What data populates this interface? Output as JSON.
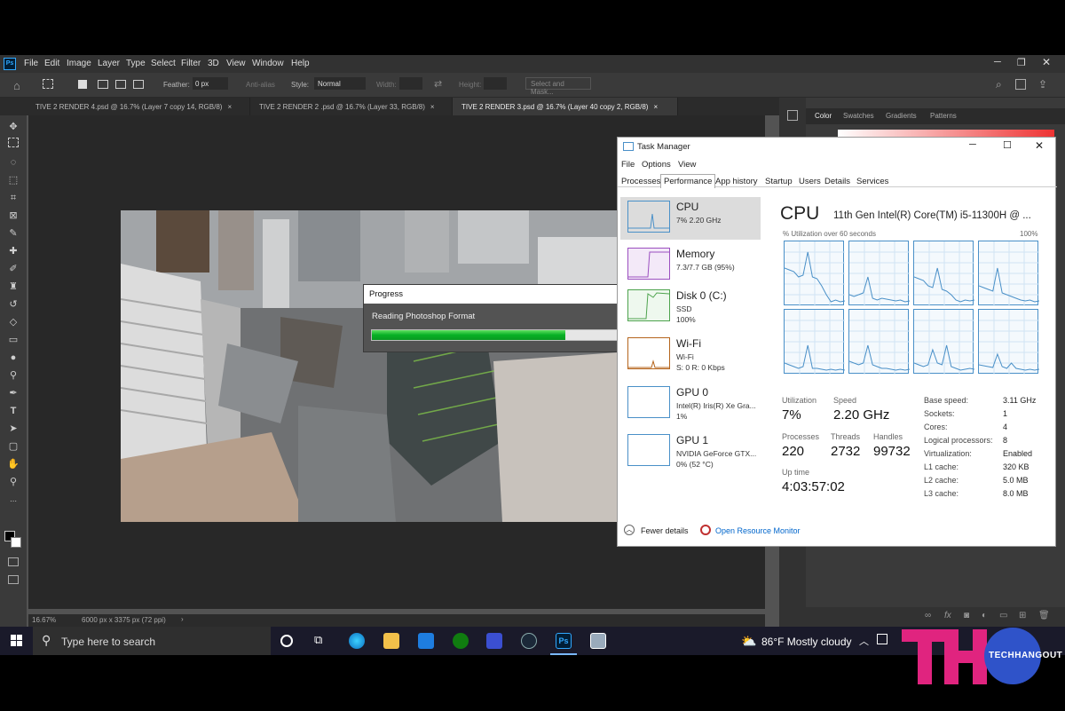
{
  "photoshop": {
    "menu": [
      "File",
      "Edit",
      "Image",
      "Layer",
      "Type",
      "Select",
      "Filter",
      "3D",
      "View",
      "Window",
      "Help"
    ],
    "options": {
      "feather_label": "Feather:",
      "feather_value": "0 px",
      "antialias_label": "Anti-alias",
      "style_label": "Style:",
      "style_value": "Normal",
      "width_label": "Width:",
      "height_label": "Height:",
      "select_mask": "Select and Mask..."
    },
    "tabs": [
      "TIVE 2 RENDER 4.psd @ 16.7% (Layer 7 copy 14, RGB/8)",
      "TIVE 2 RENDER 2 .psd @ 16.7% (Layer 33, RGB/8)",
      "TIVE 2 RENDER 3.psd @ 16.7% (Layer 40 copy 2, RGB/8)"
    ],
    "status": {
      "zoom": "16.67%",
      "doc_size": "6000 px x 3375 px (72 ppi)",
      "chevron": "›"
    },
    "panel_tabs": [
      "Color",
      "Swatches",
      "Gradients",
      "Patterns"
    ]
  },
  "progress": {
    "title": "Progress",
    "message": "Reading Photoshop Format",
    "value": 0.79
  },
  "taskmanager": {
    "title": "Task Manager",
    "menu": [
      "File",
      "Options",
      "View"
    ],
    "tabs": [
      "Processes",
      "Performance",
      "App history",
      "Startup",
      "Users",
      "Details",
      "Services"
    ],
    "side": [
      {
        "title": "CPU",
        "sub1": "7%  2.20 GHz",
        "sub2": "",
        "color": "#4a90c8"
      },
      {
        "title": "Memory",
        "sub1": "7.3/7.7 GB (95%)",
        "sub2": "",
        "color": "#9b4fc0"
      },
      {
        "title": "Disk 0 (C:)",
        "sub1": "SSD",
        "sub2": "100%",
        "color": "#4da34d"
      },
      {
        "title": "Wi-Fi",
        "sub1": "Wi-Fi",
        "sub2": "S: 0 R: 0 Kbps",
        "color": "#b5651d"
      },
      {
        "title": "GPU 0",
        "sub1": "Intel(R) Iris(R) Xe Gra...",
        "sub2": "1%",
        "color": "#4a90c8"
      },
      {
        "title": "GPU 1",
        "sub1": "NVIDIA GeForce GTX...",
        "sub2": "0%  (52 °C)",
        "color": "#4a90c8"
      }
    ],
    "main_title": "CPU",
    "cpu_name": "11th Gen Intel(R) Core(TM) i5-11300H @ ...",
    "util_label": "% Utilization over 60 seconds",
    "util_max": "100%",
    "stats": {
      "utilization_label": "Utilization",
      "utilization": "7%",
      "speed_label": "Speed",
      "speed": "2.20 GHz",
      "processes_label": "Processes",
      "processes": "220",
      "threads_label": "Threads",
      "threads": "2732",
      "handles_label": "Handles",
      "handles": "99732",
      "uptime_label": "Up time",
      "uptime": "4:03:57:02"
    },
    "specs": [
      {
        "k": "Base speed:",
        "v": "3.11 GHz"
      },
      {
        "k": "Sockets:",
        "v": "1"
      },
      {
        "k": "Cores:",
        "v": "4"
      },
      {
        "k": "Logical processors:",
        "v": "8"
      },
      {
        "k": "Virtualization:",
        "v": "Enabled"
      },
      {
        "k": "L1 cache:",
        "v": "320 KB"
      },
      {
        "k": "L2 cache:",
        "v": "5.0 MB"
      },
      {
        "k": "L3 cache:",
        "v": "8.0 MB"
      }
    ],
    "fewer_details": "Fewer details",
    "resource_monitor": "Open Resource Monitor"
  },
  "taskbar": {
    "search": "Type here to search",
    "weather": "86°F  Mostly cloudy"
  },
  "logo": {
    "text": "TECHHANGOUT",
    "mark": "TH"
  }
}
